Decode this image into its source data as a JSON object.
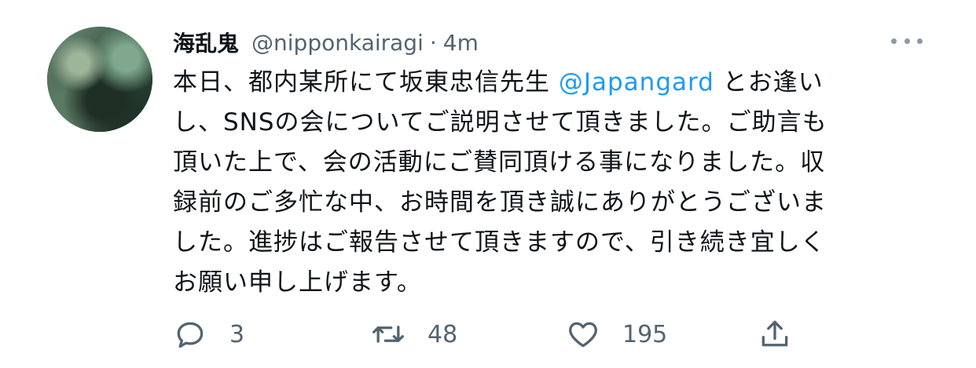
{
  "tweet": {
    "display_name": "海乱鬼",
    "handle": "@nipponkairagi",
    "separator": "·",
    "time": "4m",
    "text_lines": [
      [
        "本日、都内某所にて坂東忠信先生 ",
        "@Japangard",
        " とお逢い"
      ],
      [
        "し、SNSの会についてご説明させて頂きました。ご助言も"
      ],
      [
        "頂いた上で、会の活動にご賛同頂ける事になりました。収"
      ],
      [
        "録前のご多忙な中、お時間を頂き誠にありがとうございま"
      ],
      [
        "した。進捗はご報告させて頂きますので、引き続き宜しく"
      ],
      [
        "お願い申し上げます。"
      ]
    ],
    "text_before_mention": "本日、都内某所にて坂東忠信先生 ",
    "mention": "@Japangard",
    "text_after_mention_line1": " とお逢い",
    "line2": "し、SNSの会についてご説明させて頂きました。ご助言も",
    "line3": "頂いた上で、会の活動にご賛同頂ける事になりました。収",
    "line4": "録前のご多忙な中、お時間を頂き誠にありがとうございま",
    "line5": "した。進捗はご報告させて頂きますので、引き続き宜しく",
    "line6": "お願い申し上げます。"
  },
  "actions": {
    "reply_count": "3",
    "retweet_count": "48",
    "like_count": "195"
  },
  "icons": {
    "more": "more-dots-icon",
    "reply": "reply-icon",
    "retweet": "retweet-icon",
    "like": "heart-icon",
    "share": "share-icon"
  },
  "colors": {
    "text": "#0f1419",
    "secondary": "#536471",
    "link": "#1d9bf0"
  }
}
